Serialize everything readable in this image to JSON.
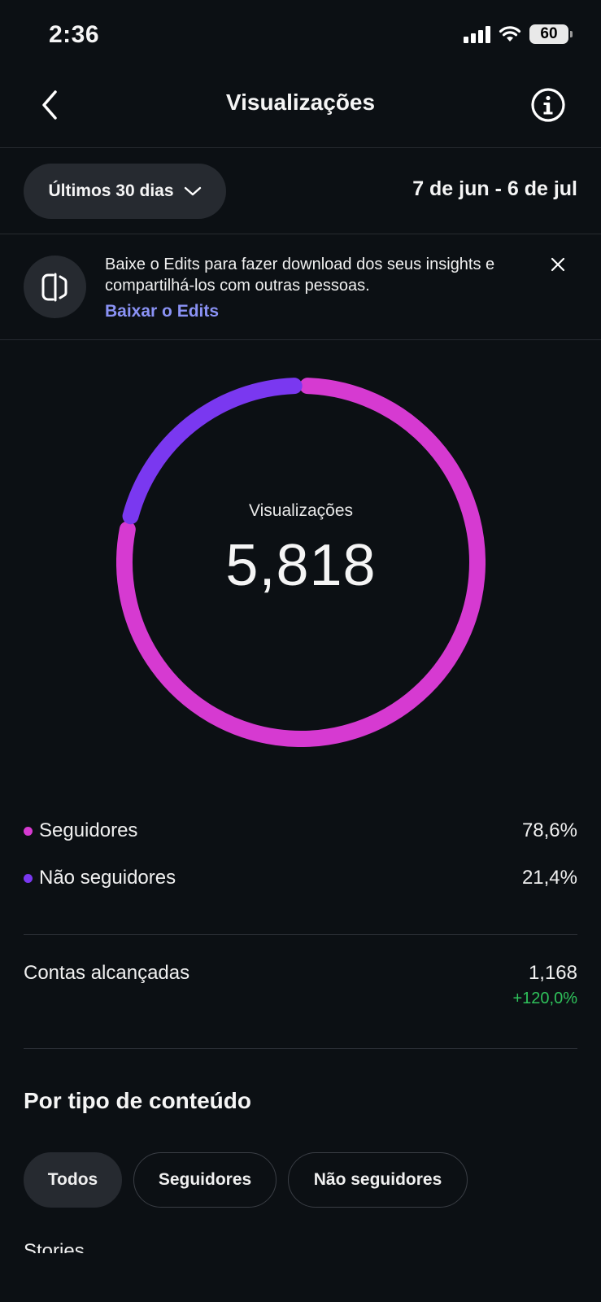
{
  "status_bar": {
    "time": "2:36",
    "battery": "60"
  },
  "header": {
    "title": "Visualizações"
  },
  "date_filter": {
    "selected": "Últimos 30 dias",
    "range": "7 de jun - 6 de jul"
  },
  "banner": {
    "text": "Baixe o Edits para fazer download dos seus insights e compartilhá-los com outras pessoas.",
    "link": "Baixar o Edits"
  },
  "donut": {
    "label": "Visualizações",
    "value": "5,818",
    "followers_fraction": 0.786,
    "followers_color": "#d63ad1",
    "non_followers_color": "#7a38f0"
  },
  "legend": [
    {
      "label": "Seguidores",
      "value": "78,6%",
      "color": "#d63ad1"
    },
    {
      "label": "Não seguidores",
      "value": "21,4%",
      "color": "#7a38f0"
    }
  ],
  "metrics": {
    "accounts_reached": {
      "label": "Contas alcançadas",
      "value": "1,168",
      "change": "+120,0%"
    }
  },
  "content_type": {
    "title": "Por tipo de conteúdo",
    "tabs": [
      "Todos",
      "Seguidores",
      "Não seguidores"
    ],
    "active_tab": "Todos",
    "next_section": "Stories"
  },
  "icons": {
    "back": "chevron-left-icon",
    "info": "info-icon",
    "dropdown": "chevron-down-icon",
    "close": "close-icon",
    "edits": "edits-logo-icon"
  }
}
